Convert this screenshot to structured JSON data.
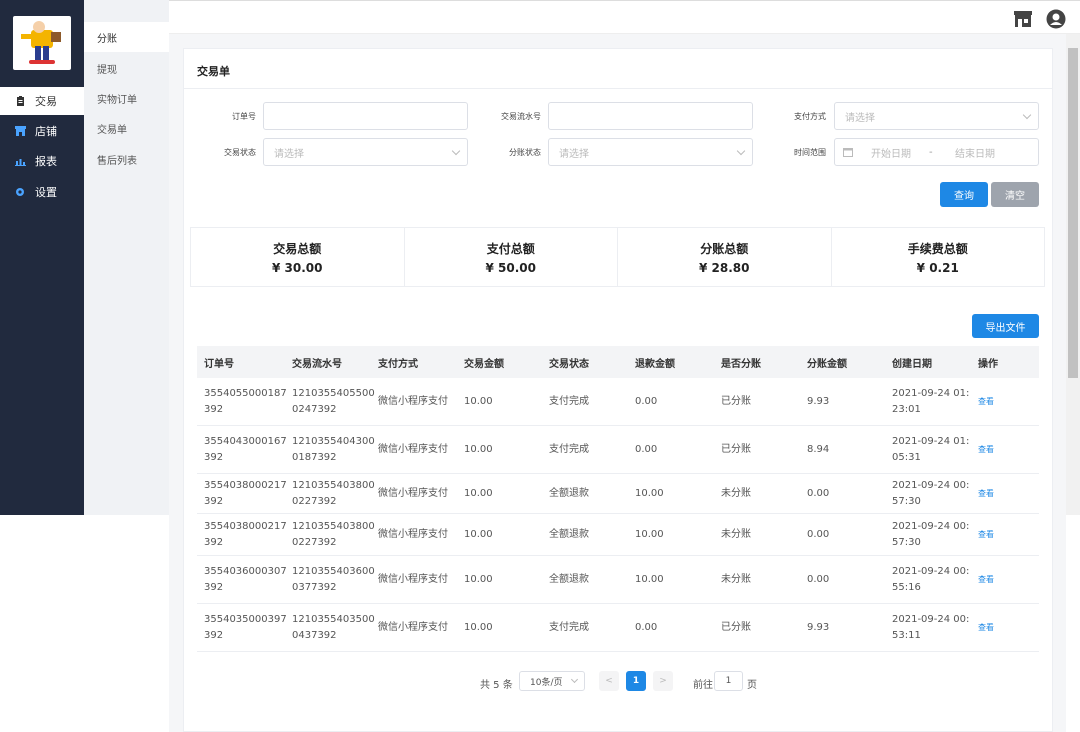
{
  "sidebar": {
    "items": [
      {
        "label": "交易",
        "icon": "clipboard-icon"
      },
      {
        "label": "店铺",
        "icon": "store-icon"
      },
      {
        "label": "报表",
        "icon": "chart-icon"
      },
      {
        "label": "设置",
        "icon": "gear-icon"
      }
    ]
  },
  "submenu": {
    "items": [
      {
        "label": "分账"
      },
      {
        "label": "提现"
      },
      {
        "label": "实物订单"
      },
      {
        "label": "交易单"
      },
      {
        "label": "售后列表"
      }
    ]
  },
  "page": {
    "title": "交易单"
  },
  "filters": {
    "order_no_label": "订单号",
    "serial_no_label": "交易流水号",
    "pay_method_label": "支付方式",
    "pay_method_placeholder": "请选择",
    "trade_status_label": "交易状态",
    "trade_status_placeholder": "请选择",
    "split_status_label": "分账状态",
    "split_status_placeholder": "请选择",
    "time_range_label": "时间范围",
    "start_date_placeholder": "开始日期",
    "range_separator": "-",
    "end_date_placeholder": "结束日期",
    "query_label": "查询",
    "clear_label": "清空"
  },
  "stats": [
    {
      "label": "交易总额",
      "value": "¥ 30.00"
    },
    {
      "label": "支付总额",
      "value": "¥ 50.00"
    },
    {
      "label": "分账总额",
      "value": "¥ 28.80"
    },
    {
      "label": "手续费总额",
      "value": "¥ 0.21"
    }
  ],
  "export_label": "导出文件",
  "table": {
    "headers": [
      "订单号",
      "交易流水号",
      "支付方式",
      "交易金额",
      "交易状态",
      "退款金额",
      "是否分账",
      "分账金额",
      "创建日期",
      "操作"
    ],
    "rows": [
      {
        "order_1": "3554055000187",
        "order_2": "392",
        "serial_1": "1210355405500",
        "serial_2": "0247392",
        "pay": "微信小程序支付",
        "amount": "10.00",
        "status": "支付完成",
        "refund": "0.00",
        "split": "已分账",
        "split_amount": "9.93",
        "date_1": "2021-09-24 01:",
        "date_2": "23:01",
        "action": "查看"
      },
      {
        "order_1": "3554043000167",
        "order_2": "392",
        "serial_1": "1210355404300",
        "serial_2": "0187392",
        "pay": "微信小程序支付",
        "amount": "10.00",
        "status": "支付完成",
        "refund": "0.00",
        "split": "已分账",
        "split_amount": "8.94",
        "date_1": "2021-09-24 01:",
        "date_2": "05:31",
        "action": "查看"
      },
      {
        "order_1": "3554038000217",
        "order_2": "392",
        "serial_1": "1210355403800",
        "serial_2": "0227392",
        "pay": "微信小程序支付",
        "amount": "10.00",
        "status": "全额退款",
        "refund": "10.00",
        "split": "未分账",
        "split_amount": "0.00",
        "date_1": "2021-09-24 00:",
        "date_2": "57:30",
        "action": "查看"
      },
      {
        "order_1": "3554038000217",
        "order_2": "392",
        "serial_1": "1210355403800",
        "serial_2": "0227392",
        "pay": "微信小程序支付",
        "amount": "10.00",
        "status": "全额退款",
        "refund": "10.00",
        "split": "未分账",
        "split_amount": "0.00",
        "date_1": "2021-09-24 00:",
        "date_2": "57:30",
        "action": "查看"
      },
      {
        "order_1": "3554036000307",
        "order_2": "392",
        "serial_1": "1210355403600",
        "serial_2": "0377392",
        "pay": "微信小程序支付",
        "amount": "10.00",
        "status": "全额退款",
        "refund": "10.00",
        "split": "未分账",
        "split_amount": "0.00",
        "date_1": "2021-09-24 00:",
        "date_2": "55:16",
        "action": "查看"
      },
      {
        "order_1": "3554035000397",
        "order_2": "392",
        "serial_1": "1210355403500",
        "serial_2": "0437392",
        "pay": "微信小程序支付",
        "amount": "10.00",
        "status": "支付完成",
        "refund": "0.00",
        "split": "已分账",
        "split_amount": "9.93",
        "date_1": "2021-09-24 00:",
        "date_2": "53:11",
        "action": "查看"
      }
    ]
  },
  "pagination": {
    "total": "共 5 条",
    "page_size": "10条/页",
    "prev": "<",
    "current": "1",
    "next": ">",
    "goto_label": "前往",
    "goto_value": "1",
    "page_suffix": "页"
  },
  "colors": {
    "primary": "#1e88e5",
    "sidebar": "#212a3e"
  }
}
